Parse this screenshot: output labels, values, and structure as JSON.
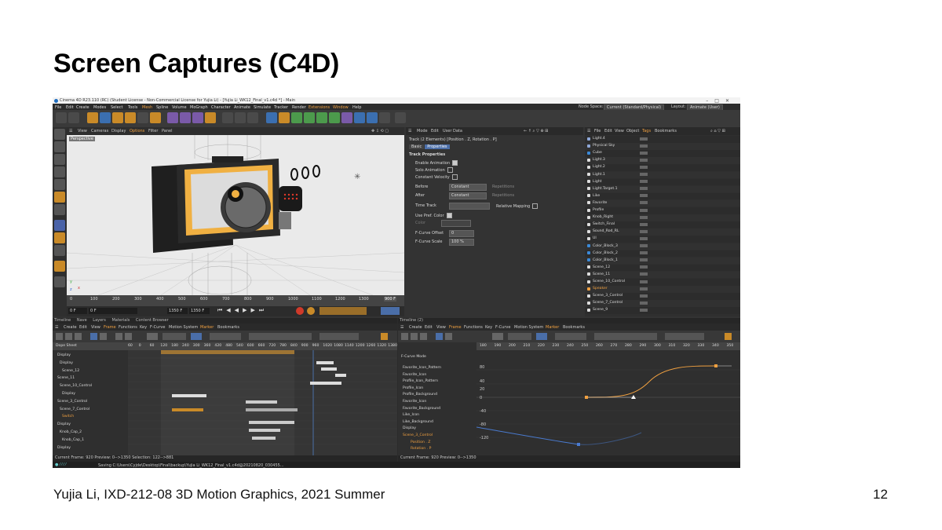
{
  "slide": {
    "title": "Screen Captures (C4D)",
    "footer": "Yujia Li, IXD-212-08 3D Motion Graphics, 2021 Summer",
    "page_number": "12"
  },
  "app": {
    "window_title": "Cinema 4D R23.110 (RC) (Student License - Non-Commercial License for Yujia Li) - [Yujia Li_WK12_Final_v1.c4d *] - Main",
    "menu": [
      "File",
      "Edit",
      "Create",
      "Modes",
      "Select",
      "Tools",
      "Mesh",
      "Spline",
      "Volume",
      "MoGraph",
      "Character",
      "Animate",
      "Simulate",
      "Tracker",
      "Render",
      "Extensions",
      "Window",
      "Help"
    ],
    "node_space_label": "Node Space:",
    "node_space_value": "Current (Standard/Physical)",
    "layout_label": "Layout:",
    "layout_value": "Animate (User)"
  },
  "viewport": {
    "menu": [
      "View",
      "Cameras",
      "Display",
      "Options",
      "Filter",
      "Panel"
    ],
    "camera_label": "Perspective",
    "ruler_ticks": [
      "0",
      "100",
      "200",
      "300",
      "400",
      "500",
      "600",
      "700",
      "800",
      "900",
      "1000",
      "1100",
      "1200",
      "1300"
    ],
    "frame_field": "900 F",
    "start_field": "0 F",
    "current_field": "0 F",
    "end_field_a": "1350 F",
    "end_field_b": "1350 F"
  },
  "attributes": {
    "menu": [
      "Mode",
      "Edit",
      "User Data"
    ],
    "track_title": "Track (2 Elements) [Position . Z, Rotation . P]",
    "tabs": [
      "Basic",
      "Properties"
    ],
    "section": "Track Properties",
    "enable_animation": "Enable Animation",
    "solo_animation": "Solo Animation",
    "constant_velocity": "Constant Velocity",
    "before_label": "Before",
    "before_value": "Constant",
    "after_label": "After",
    "after_value": "Constant",
    "repetitions": "Repetitions",
    "time_track": "Time Track",
    "relative_mapping": "Relative Mapping",
    "use_pref_color": "Use Pref. Color",
    "color": "Color",
    "fcurve_offset_label": "F-Curve Offset",
    "fcurve_offset_value": "0",
    "fcurve_scale_label": "F-Curve Scale",
    "fcurve_scale_value": "100 %"
  },
  "objects": {
    "menu": [
      "File",
      "Edit",
      "View",
      "Object",
      "Tags",
      "Bookmarks"
    ],
    "items": [
      "Light.4",
      "Physical Sky",
      "Cube",
      "Light.3",
      "Light.2",
      "Light.1",
      "Light",
      "Light.Target.1",
      "Like",
      "Favorite",
      "Profile",
      "Knob_Right",
      "Switch_Final",
      "Sound_Rod_RL",
      "UI",
      "Color_Block_3",
      "Color_Block_2",
      "Color_Block_1",
      "Scene_12",
      "Scene_11",
      "Scene_10_Control",
      "Speaker",
      "Scene_3_Control",
      "Scene_7_Control",
      "Scene_9"
    ]
  },
  "timeline_left": {
    "tabs": [
      "Timeline",
      "Nave",
      "Layers",
      "Materials",
      "Content Browser"
    ],
    "menu": [
      "Create",
      "Edit",
      "View",
      "Frame",
      "Functions",
      "Key",
      "F-Curve",
      "Motion System",
      "Marker",
      "Bookmarks"
    ],
    "mode_label": "Dope Sheet",
    "ruler_ticks": [
      "60",
      "0",
      "60",
      "120",
      "180",
      "240",
      "300",
      "360",
      "420",
      "480",
      "540",
      "600",
      "660",
      "720",
      "780",
      "840",
      "900",
      "960",
      "1020",
      "1080",
      "1140",
      "1200",
      "1260",
      "1320",
      "1380"
    ],
    "items": [
      "Display",
      "Display",
      "Scene_12",
      "Scene_11",
      "Scene_10_Control",
      "Display",
      "Scene_3_Control",
      "Scene_7_Control",
      "Switch",
      "Display",
      "Knob_Cap_2",
      "Knob_Cap_1",
      "Display"
    ],
    "status": "Current Frame: 920  Preview: 0-->1350   Selection: 122-->881"
  },
  "timeline_right": {
    "tab": "Timeline (2)",
    "menu": [
      "Create",
      "Edit",
      "View",
      "Frame",
      "Functions",
      "Key",
      "F-Curve",
      "Motion System",
      "Marker",
      "Bookmarks"
    ],
    "mode_label": "F-Curve Mode",
    "ruler_ticks": [
      "180",
      "190",
      "200",
      "210",
      "220",
      "230",
      "240",
      "250",
      "260",
      "270",
      "280",
      "290",
      "300",
      "310",
      "320",
      "330",
      "340",
      "350"
    ],
    "y_ticks": [
      "80",
      "40",
      "20",
      "0",
      "-20",
      "-40",
      "-80",
      "-120"
    ],
    "items": [
      "Favorite_Icon_Pattern",
      "Favorite_Icon",
      "Profile_Icon_Pattern",
      "Profile_Icon",
      "Profile_Background",
      "Favorite_Icon",
      "Favorite_Background",
      "Like_Icon",
      "Like_Background",
      "Display",
      "Scene_3_Control",
      "Position . Z",
      "Rotation . P"
    ],
    "status": "Current Frame: 920  Preview: 0-->1350"
  },
  "statusbar": {
    "text": "Saving C:\\Users\\Cyjde\\Desktop\\Final\\backup\\Yujia Li_WK12_Final_v1.c4d@20210820_030455..."
  }
}
